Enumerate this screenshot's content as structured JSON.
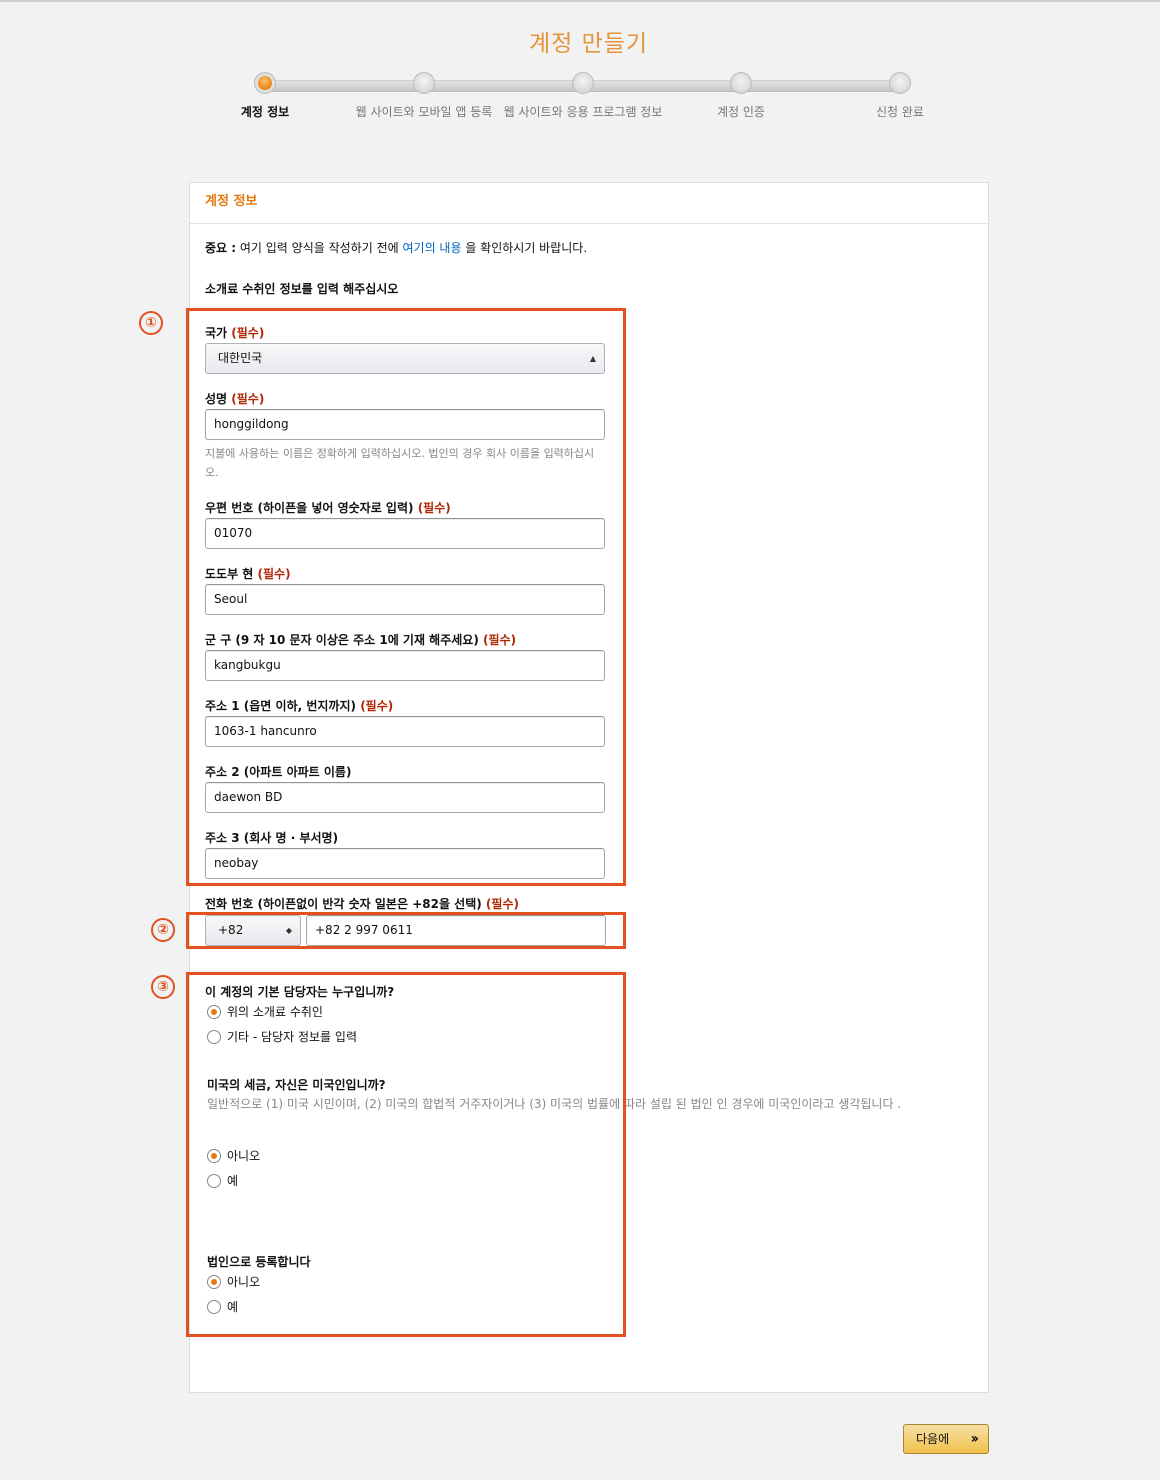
{
  "page": {
    "title": "계정 만들기"
  },
  "steps": [
    {
      "label": "계정 정보",
      "active": true
    },
    {
      "label": "웹 사이트와 모바일 앱 등록",
      "active": false
    },
    {
      "label": "웹 사이트와 응용 프로그램 정보",
      "active": false
    },
    {
      "label": "계정 인증",
      "active": false
    },
    {
      "label": "신청 완료",
      "active": false
    }
  ],
  "panel": {
    "header": "계정 정보",
    "notice": {
      "prefix": "중요 :",
      "text1": " 여기 입력 양식을 작성하기 전에 ",
      "link": "여기의 내용",
      "text2": " 을 확인하시기 바랍니다."
    },
    "section_heading": "소개료 수취인 정보를 입력 해주십시오"
  },
  "required_mark": "(필수)",
  "form": {
    "country": {
      "label": "국가",
      "value": "대한민국"
    },
    "name": {
      "label": "성명",
      "value": "honggildong",
      "hint": "지불에 사용하는 이름은 정확하게 입력하십시오. 법인의 경우 회사 이름을 입력하십시오."
    },
    "postal": {
      "label": "우편 번호 (하이픈을 넣어 영숫자로 입력)",
      "value": "01070"
    },
    "prefecture": {
      "label": "도도부 현",
      "value": "Seoul"
    },
    "district": {
      "label": "군 구 (9 자 10 문자 이상은 주소 1에 기재 해주세요)",
      "value": "kangbukgu"
    },
    "address1": {
      "label": "주소 1 (읍면 이하, 번지까지)",
      "value": "1063-1 hancunro"
    },
    "address2": {
      "label": "주소 2 (아파트 아파트 이름)",
      "value": "daewon BD"
    },
    "address3": {
      "label": "주소 3 (회사 명 · 부서명)",
      "value": "neobay"
    },
    "phone": {
      "label": "전화 번호 (하이픈없이 반각 숫자 일본은 +82을 선택)",
      "country_code": "+82",
      "value": "+82 2 997 0611"
    }
  },
  "questions": {
    "contact": {
      "label": "이 계정의 기본 담당자는 누구입니까?",
      "options": [
        "위의 소개료 수취인",
        "기타 - 담당자 정보를 입력"
      ],
      "selected": 0
    },
    "us_tax": {
      "label": "미국의 세금, 자신은 미국인입니까?",
      "description": "일반적으로 (1) 미국 시민이며, (2) 미국의 합법적 거주자이거나 (3) 미국의 법률에 따라 설립 된 법인 인 경우에 미국인이라고 생각됩니다 .",
      "options": [
        "아니오",
        "예"
      ],
      "selected": 0
    },
    "corporate": {
      "label": "법인으로 등록합니다",
      "options": [
        "아니오",
        "예"
      ],
      "selected": 0
    }
  },
  "annotations": [
    "①",
    "②",
    "③"
  ],
  "next_button": {
    "label": "다음에",
    "icon": "double-chevron-right-icon"
  },
  "colors": {
    "accent": "#e47911",
    "title": "#e59439",
    "required": "#b12704",
    "annotation": "#e1521f",
    "button": "#f0c14b"
  }
}
